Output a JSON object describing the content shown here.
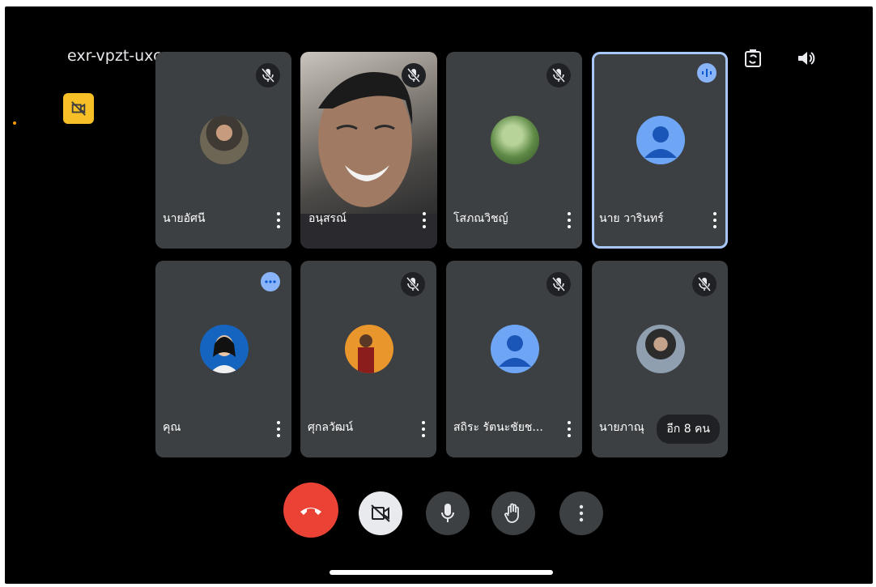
{
  "meeting": {
    "code": "exr-vpzt-uxc",
    "code_caret": "▸"
  },
  "tiles": [
    {
      "name": "นายอัศนี",
      "status": "muted",
      "avatar": "photo"
    },
    {
      "name": "อนุสรณ์",
      "status": "muted",
      "avatar": "video"
    },
    {
      "name": "โสภณวิชญ์",
      "status": "muted",
      "avatar": "photo"
    },
    {
      "name": "นาย วารินทร์",
      "status": "speaking",
      "avatar": "default-person"
    },
    {
      "name": "คุณ",
      "status": "options",
      "avatar": "photo"
    },
    {
      "name": "ศุกลวัฒน์",
      "status": "muted",
      "avatar": "photo"
    },
    {
      "name": "สถิระ รัตนะชัยช...",
      "status": "muted",
      "avatar": "default-person"
    },
    {
      "name": "นายภาณุ",
      "status": "muted",
      "avatar": "photo"
    }
  ],
  "more_participants": {
    "label": "อีก 8 คน"
  },
  "controls": [
    "end-call",
    "camera-off",
    "microphone",
    "raise-hand",
    "more-options"
  ],
  "icons": {
    "top_right": [
      "switch-camera-icon",
      "speaker-icon"
    ],
    "badge": "camera-off-icon"
  },
  "colors": {
    "background": "#000000",
    "tile": "#3c4043",
    "end_call": "#ea4335",
    "active_border": "#a8c7fa",
    "badge": "#f6c026"
  }
}
